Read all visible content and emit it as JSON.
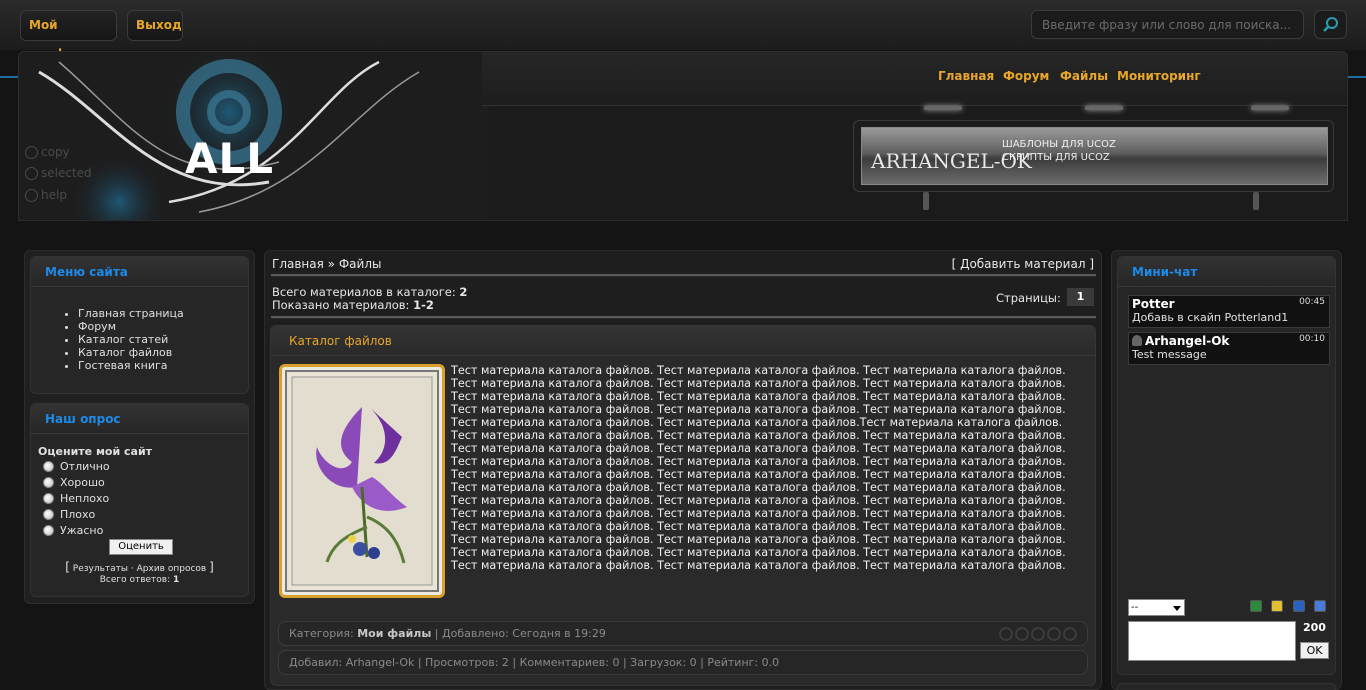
{
  "topbar": {
    "profile_label": "Мой профиль",
    "logout_label": "Выход",
    "search_placeholder": "Введите фразу или слово для поиска..."
  },
  "header": {
    "logo_text": "ALL",
    "side_links": [
      "copy",
      "selected",
      "help"
    ],
    "nav": [
      "Главная",
      "Форум",
      "Файлы",
      "Мониторинг"
    ],
    "banner_title": "ARHANGEL-OK",
    "banner_line1": "ШАБЛОНЫ ДЛЯ UCOZ",
    "banner_line2": "СКРИПТЫ ДЛЯ UCOZ"
  },
  "site_menu": {
    "title": "Меню сайта",
    "items": [
      "Главная страница",
      "Форум",
      "Каталог статей",
      "Каталог файлов",
      "Гостевая книга"
    ]
  },
  "poll": {
    "title": "Наш опрос",
    "question": "Оцените мой сайт",
    "options": [
      "Отлично",
      "Хорошо",
      "Неплохо",
      "Плохо",
      "Ужасно"
    ],
    "submit_label": "Оценить",
    "results_label": "Результаты",
    "archive_label": "Архив опросов",
    "total_label": "Всего ответов:",
    "total_value": "1"
  },
  "catalog": {
    "crumb_home": "Главная",
    "crumb_sep": "»",
    "crumb_current": "Файлы",
    "add_material": "Добавить материал",
    "total_label": "Всего материалов в каталоге:",
    "total_value": "2",
    "shown_label": "Показано материалов:",
    "shown_value": "1-2",
    "pages_label": "Страницы:",
    "page_current": "1",
    "block_title": "Каталог файлов",
    "description": "Тест материала каталога файлов. Тест материала каталога файлов. Тест материала каталога файлов. Тест материала каталога файлов. Тест материала каталога файлов. Тест материала каталога файлов. Тест материала каталога файлов. Тест материала каталога файлов. Тест материала каталога файлов. Тест материала каталога файлов. Тест материала каталога файлов. Тест материала каталога файлов. Тест материала каталога файлов. Тест материала каталога файлов.Тест материала каталога файлов. Тест материала каталога файлов. Тест материала каталога файлов. Тест материала каталога файлов. Тест материала каталога файлов. Тест материала каталога файлов. Тест материала каталога файлов. Тест материала каталога файлов. Тест материала каталога файлов. Тест материала каталога файлов. Тест материала каталога файлов. Тест материала каталога файлов. Тест материала каталога файлов. Тест материала каталога файлов. Тест материала каталога файлов. Тест материала каталога файлов. Тест материала каталога файлов. Тест материала каталога файлов. Тест материала каталога файлов. Тест материала каталога файлов. Тест материала каталога файлов. Тест материала каталога файлов. Тест материала каталога файлов. Тест материала каталога файлов. Тест материала каталога файлов. Тест материала каталога файлов. Тест материала каталога файлов. Тест материала каталога файлов. Тест материала каталога файлов. Тест материала каталога файлов. Тест материала каталога файлов. Тест материала каталога файлов. Тест материала каталога файлов. Тест материала каталога файлов.",
    "category_label": "Категория:",
    "category_value": "Мои файлы",
    "added_label": "Добавлено: Сегодня в 19:29",
    "author_line": "Добавил: Arhangel-Ok | Просмотров: 2 | Комментариев: 0 | Загрузок: 0 | Рейтинг: 0.0"
  },
  "chat": {
    "title": "Мини-чат",
    "messages": [
      {
        "user": "Potter",
        "time": "00:45",
        "text": "Добавь в скайп Potterland1"
      },
      {
        "user": "Arhangel-Ok",
        "time": "00:10",
        "text": "Test message"
      }
    ],
    "select_value": "--",
    "char_count": "200",
    "ok_label": "OK"
  },
  "colors": {
    "accent_orange": "#e8a72a",
    "accent_blue": "#1e8ae8"
  }
}
